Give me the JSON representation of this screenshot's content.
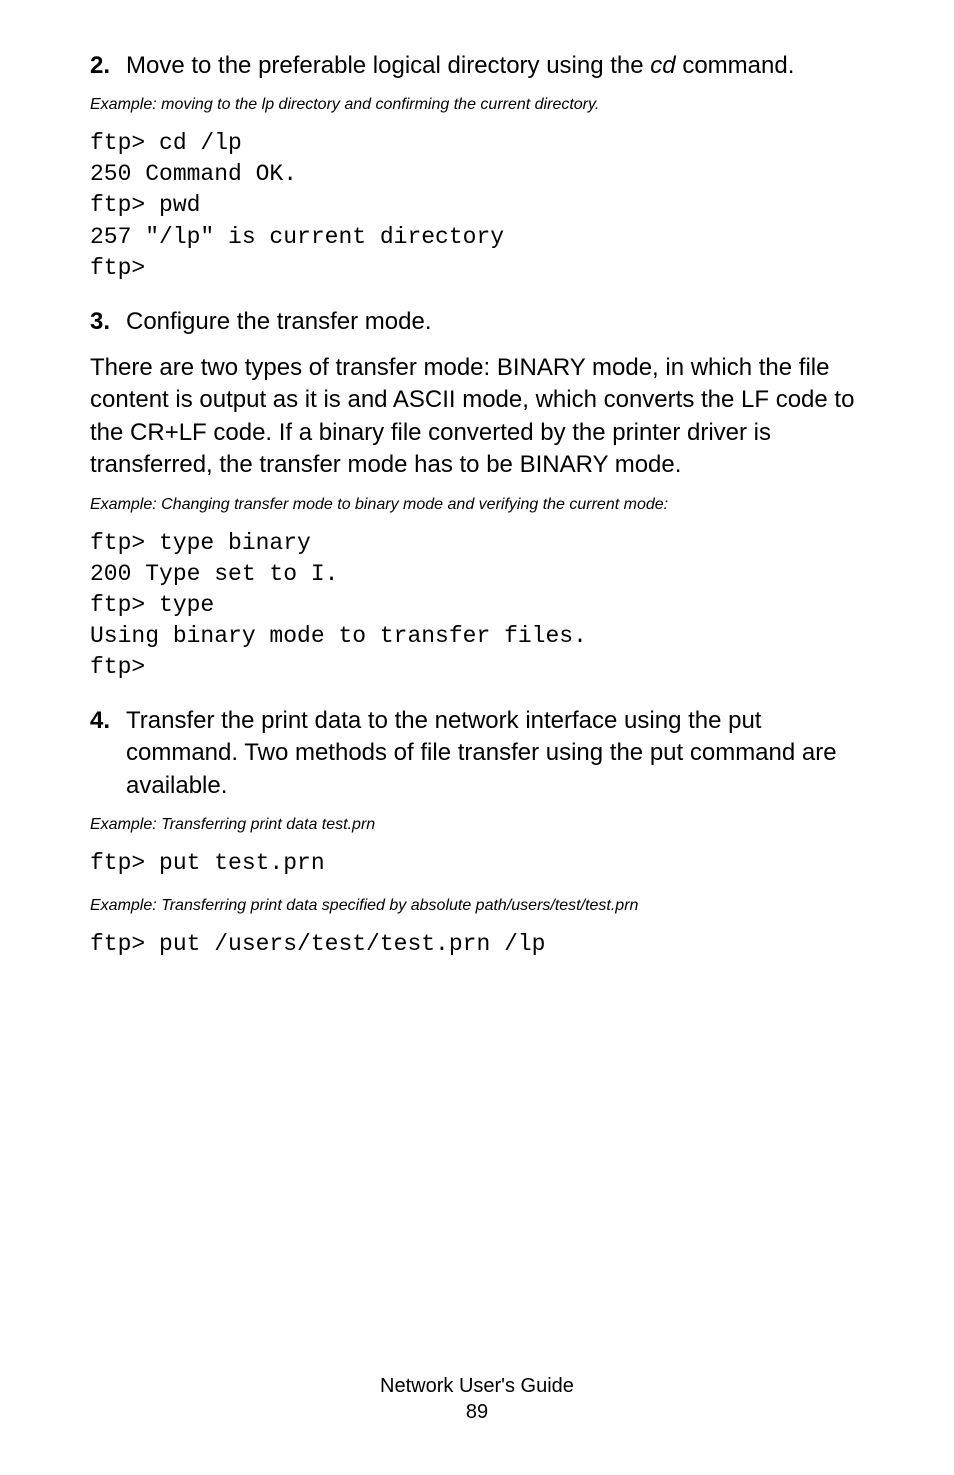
{
  "steps": [
    {
      "num": "2.",
      "intro_pre": "Move to the preferable logical directory using the ",
      "intro_em": "cd",
      "intro_post": " command.",
      "example": "Example: moving to the lp directory and confirming the current directory.",
      "code": "ftp> cd /lp\n250 Command OK.\nftp> pwd\n257 \"/lp\" is current directory\nftp>"
    },
    {
      "num": "3.",
      "intro_text": "Configure the transfer mode.",
      "para": "There are two types of transfer mode: BINARY mode, in which the file content is output as it is and ASCII mode, which converts the LF code to the CR+LF code. If a binary file converted by the printer driver is transferred, the transfer mode has to be BINARY mode.",
      "example": "Example: Changing transfer mode to binary mode and verifying the current mode:",
      "code": "ftp> type binary\n200 Type set to I.\nftp> type\nUsing binary mode to transfer files.\nftp>"
    },
    {
      "num": "4.",
      "intro_text": "Transfer the print data to the network interface using the put command. Two methods of file transfer using the put command are available.",
      "example1": "Example: Transferring print data test.prn",
      "code1": "ftp> put test.prn",
      "example2": "Example: Transferring print data specified by absolute path/users/test/test.prn",
      "code2": "ftp> put /users/test/test.prn /lp"
    }
  ],
  "footer": {
    "title": "Network User's Guide",
    "page": "89"
  }
}
